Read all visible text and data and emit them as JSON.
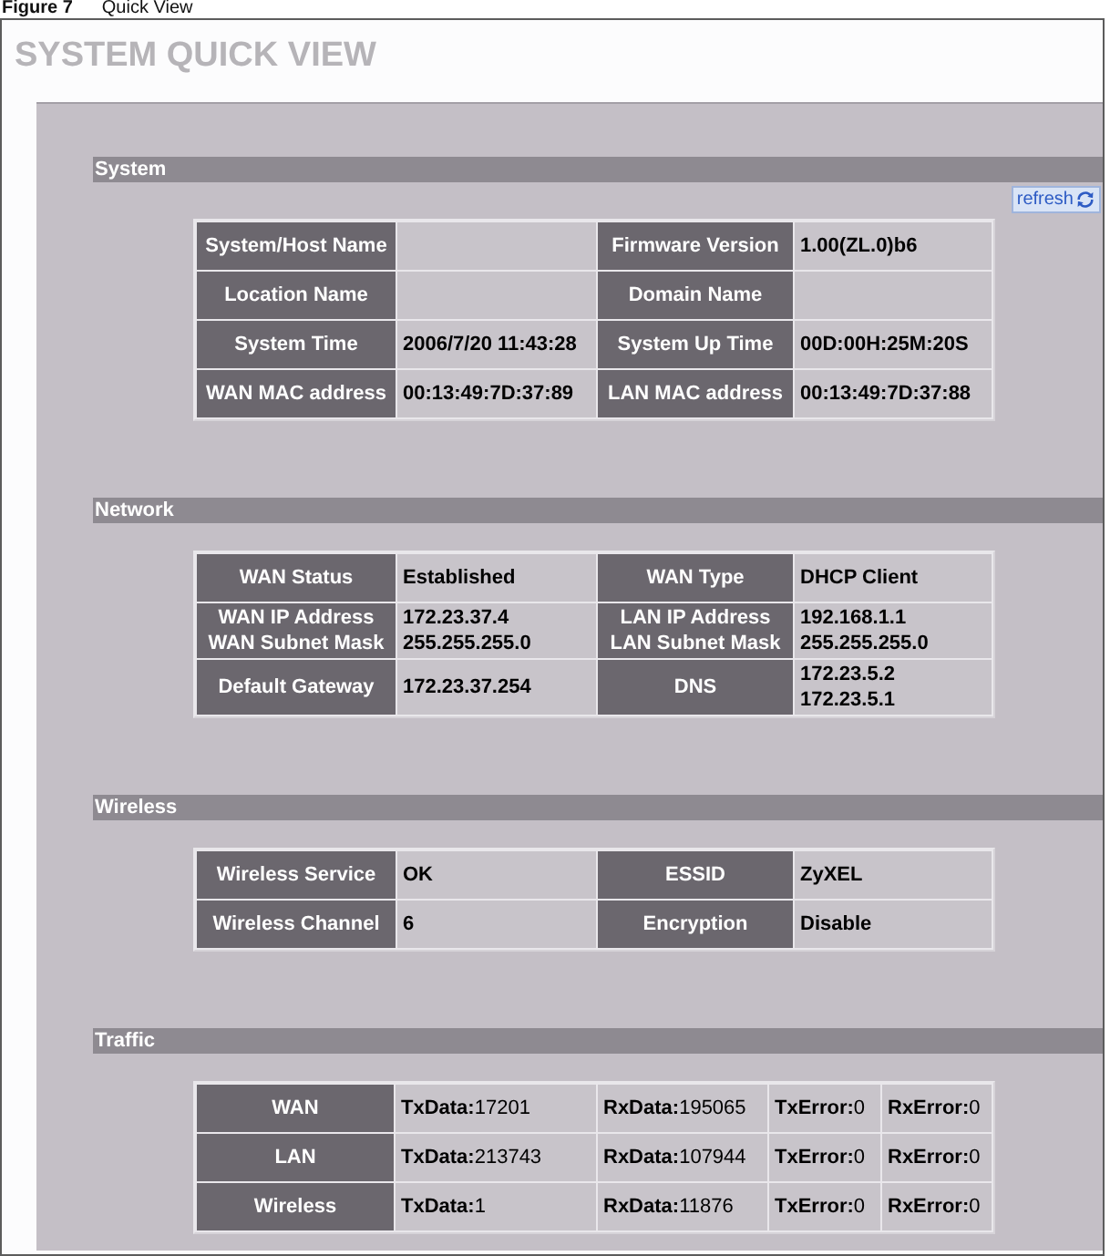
{
  "caption": {
    "number": "Figure 7",
    "title": "Quick View"
  },
  "title": "SYSTEM QUICK VIEW",
  "sections": [
    {
      "title": "System",
      "kind": "info",
      "refresh_link": "refresh",
      "rows": [
        [
          {
            "kind": "label",
            "lines": [
              "System/Host Name"
            ]
          },
          {
            "kind": "value"
          },
          {
            "kind": "label",
            "lines": [
              "Firmware Version"
            ]
          },
          {
            "kind": "value",
            "lines": [
              "1.00(ZL.0)b6"
            ]
          }
        ],
        [
          {
            "kind": "label",
            "lines": [
              "Location Name"
            ]
          },
          {
            "kind": "value"
          },
          {
            "kind": "label",
            "lines": [
              "Domain Name"
            ]
          },
          {
            "kind": "value"
          }
        ],
        [
          {
            "kind": "label",
            "lines": [
              "System Time"
            ]
          },
          {
            "kind": "value",
            "lines": [
              "2006/7/20 11:43:28"
            ]
          },
          {
            "kind": "label",
            "lines": [
              "System Up Time"
            ]
          },
          {
            "kind": "value",
            "lines": [
              "00D:00H:25M:20S"
            ]
          }
        ],
        [
          {
            "kind": "label",
            "lines": [
              "WAN MAC address"
            ]
          },
          {
            "kind": "value",
            "lines": [
              "00:13:49:7D:37:89"
            ]
          },
          {
            "kind": "label",
            "lines": [
              "LAN MAC address"
            ]
          },
          {
            "kind": "value",
            "lines": [
              "00:13:49:7D:37:88"
            ]
          }
        ]
      ]
    },
    {
      "title": "Network",
      "kind": "info",
      "rows": [
        [
          {
            "kind": "label",
            "lines": [
              "WAN Status"
            ]
          },
          {
            "kind": "value",
            "lines": [
              "Established"
            ]
          },
          {
            "kind": "label",
            "lines": [
              "WAN Type"
            ]
          },
          {
            "kind": "value",
            "lines": [
              "DHCP Client"
            ]
          }
        ],
        [
          {
            "kind": "label",
            "lines": [
              "WAN IP Address",
              "WAN Subnet Mask"
            ]
          },
          {
            "kind": "value",
            "lines": [
              "172.23.37.4",
              "255.255.255.0"
            ]
          },
          {
            "kind": "label",
            "lines": [
              "LAN IP Address",
              "LAN Subnet Mask"
            ]
          },
          {
            "kind": "value",
            "lines": [
              "192.168.1.1",
              "255.255.255.0"
            ]
          }
        ],
        [
          {
            "kind": "label",
            "lines": [
              "Default Gateway"
            ]
          },
          {
            "kind": "value",
            "lines": [
              "172.23.37.254"
            ]
          },
          {
            "kind": "label",
            "lines": [
              "DNS"
            ]
          },
          {
            "kind": "value",
            "lines": [
              "172.23.5.2",
              "172.23.5.1"
            ]
          }
        ]
      ]
    },
    {
      "title": "Wireless",
      "kind": "info",
      "rows": [
        [
          {
            "kind": "label",
            "lines": [
              "Wireless Service"
            ]
          },
          {
            "kind": "value",
            "lines": [
              "OK"
            ]
          },
          {
            "kind": "label",
            "lines": [
              "ESSID"
            ]
          },
          {
            "kind": "value",
            "lines": [
              "ZyXEL"
            ]
          }
        ],
        [
          {
            "kind": "label",
            "lines": [
              "Wireless Channel"
            ]
          },
          {
            "kind": "value",
            "lines": [
              "6"
            ]
          },
          {
            "kind": "label",
            "lines": [
              "Encryption"
            ]
          },
          {
            "kind": "value",
            "lines": [
              "Disable"
            ]
          }
        ]
      ]
    },
    {
      "title": "Traffic",
      "kind": "traffic",
      "rows": [
        [
          {
            "kind": "label",
            "lines": [
              "WAN"
            ]
          },
          {
            "kind": "value",
            "lines": [
              "**TxData:**17201"
            ]
          },
          {
            "kind": "value",
            "lines": [
              "**RxData:**195065"
            ]
          },
          {
            "kind": "value",
            "lines": [
              "**TxError:**0"
            ]
          },
          {
            "kind": "value",
            "lines": [
              "**RxError:**0"
            ]
          }
        ],
        [
          {
            "kind": "label",
            "lines": [
              "LAN"
            ]
          },
          {
            "kind": "value",
            "lines": [
              "**TxData:**213743"
            ]
          },
          {
            "kind": "value",
            "lines": [
              "**RxData:**107944"
            ]
          },
          {
            "kind": "value",
            "lines": [
              "**TxError:**0"
            ]
          },
          {
            "kind": "value",
            "lines": [
              "**RxError:**0"
            ]
          }
        ],
        [
          {
            "kind": "label",
            "lines": [
              "Wireless"
            ]
          },
          {
            "kind": "value",
            "lines": [
              "**TxData:**1"
            ]
          },
          {
            "kind": "value",
            "lines": [
              "**RxData:**11876"
            ]
          },
          {
            "kind": "value",
            "lines": [
              "**TxError:**0"
            ]
          },
          {
            "kind": "value",
            "lines": [
              "**RxError:**0"
            ]
          }
        ]
      ]
    }
  ]
}
